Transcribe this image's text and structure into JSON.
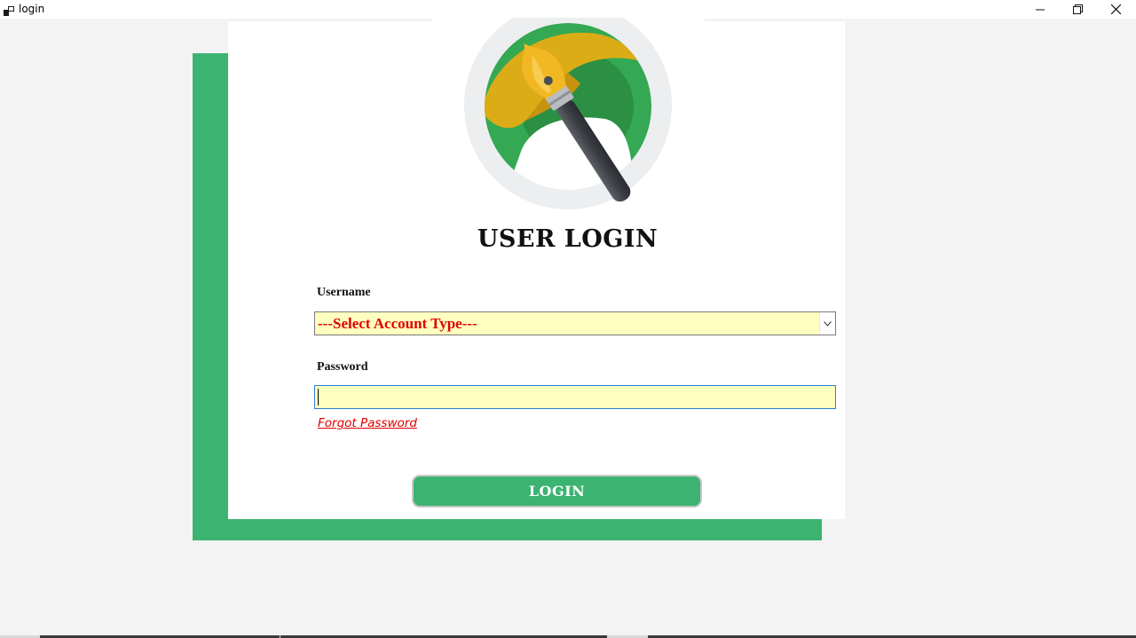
{
  "window": {
    "title": "login",
    "icon": "app-window-icon",
    "controls": [
      "minimize-icon",
      "restore-icon",
      "close-icon"
    ]
  },
  "logo": {
    "icon": "paint-brush-logo-icon",
    "colors": {
      "ring": "#eceef0",
      "green": "#34a853",
      "gold": "#d9a915",
      "handle": "#4a4d52"
    }
  },
  "form": {
    "title": "USER LOGIN",
    "username_label": "Username",
    "account_select": {
      "selected": "---Select Account Type---",
      "icon": "chevron-down-icon"
    },
    "password_label": "Password",
    "password_value": "",
    "forgot_password": "Forgot Password",
    "login_button": "LOGIN"
  },
  "colors": {
    "accent_green": "#3cb371",
    "input_bg": "#ffffc0",
    "link_red": "#e00000",
    "page_bg": "#f3f3f3"
  }
}
